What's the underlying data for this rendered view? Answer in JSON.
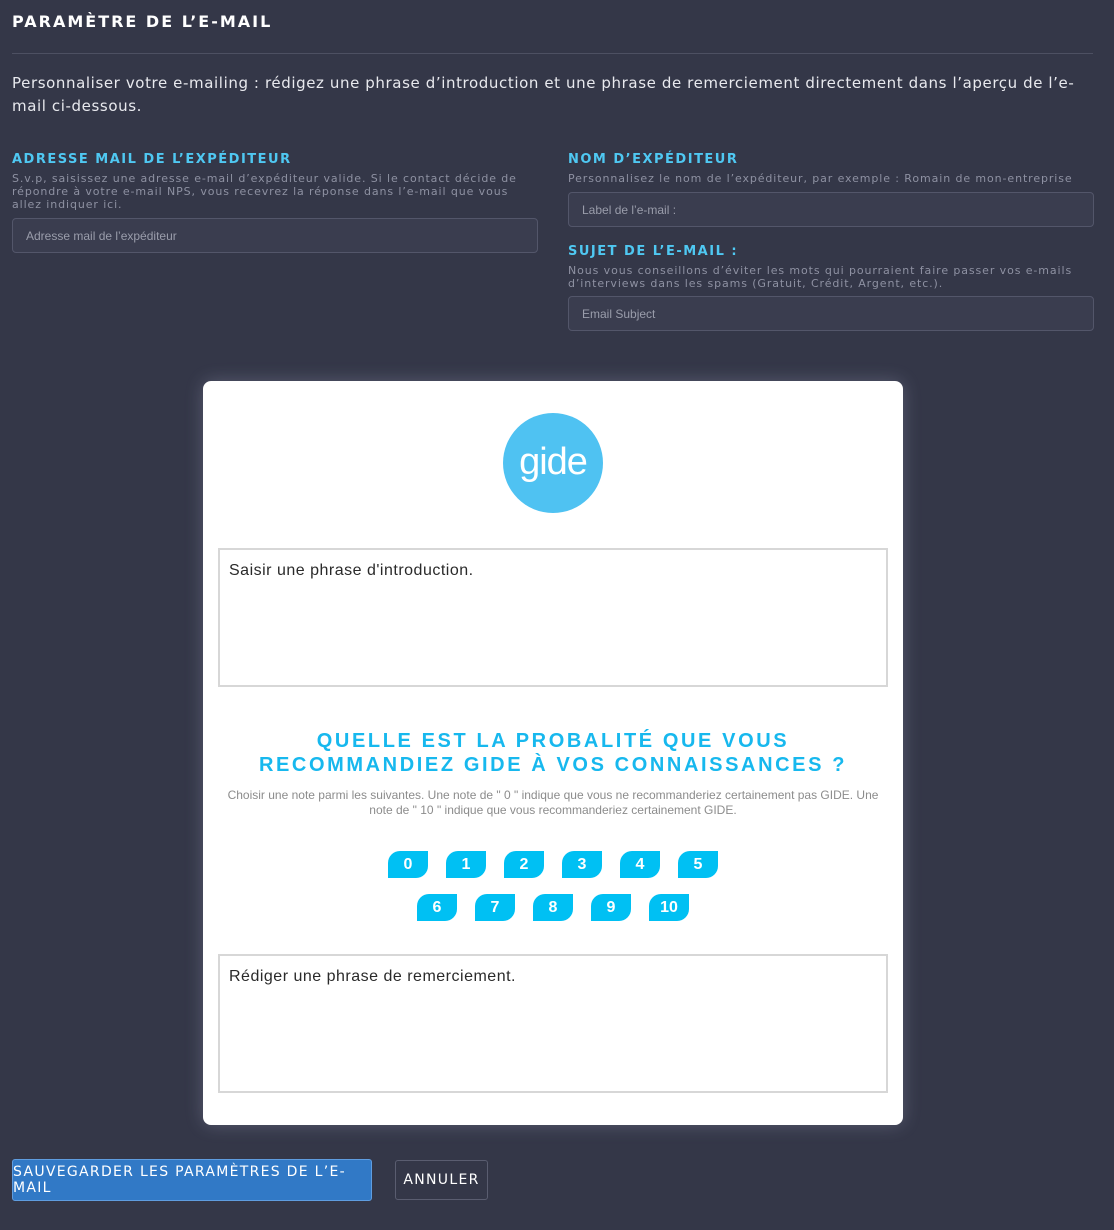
{
  "page": {
    "title": "PARAMÈTRE DE L’E-MAIL",
    "intro": "Personnaliser votre e-mailing : rédigez une phrase d’introduction et une phrase de remerciement directement dans l’aperçu de l’e-mail ci-dessous."
  },
  "sender_email": {
    "label": "ADRESSE MAIL DE L’EXPÉDITEUR",
    "help": "S.v.p, saisissez une adresse e-mail d’expéditeur valide. Si le contact décide de répondre à votre e-mail NPS, vous recevrez la réponse dans l’e-mail que vous allez indiquer ici.",
    "value": "",
    "placeholder": "Adresse mail de l’expéditeur"
  },
  "sender_name": {
    "label": "NOM D’EXPÉDITEUR",
    "help": "Personnalisez le nom de l’expéditeur, par exemple : Romain de mon-entreprise",
    "value": "",
    "placeholder": "Label de l’e-mail :"
  },
  "subject": {
    "label": "SUJET DE L’E-MAIL :",
    "help": "Nous vous conseillons d’éviter les mots qui pourraient faire passer vos e-mails d’interviews dans les spams (Gratuit, Crédit, Argent, etc.).",
    "value": "",
    "placeholder": "Email Subject"
  },
  "preview": {
    "logo_text": "gide",
    "intro_text": "Saisir une phrase d'introduction.",
    "question": "QUELLE EST LA PROBALITÉ QUE VOUS RECOMMANDIEZ GIDE À VOS CONNAISSANCES ?",
    "question_help": "Choisir une note parmi les suivantes. Une note de \" 0 \" indique que vous ne recommanderiez certainement pas GIDE. Une note de \" 10 \" indique que vous recommanderiez certainement GIDE.",
    "scores_row1": [
      "0",
      "1",
      "2",
      "3",
      "4",
      "5"
    ],
    "scores_row2": [
      "6",
      "7",
      "8",
      "9",
      "10"
    ],
    "thanks_text": "Rédiger une phrase de remerciement."
  },
  "actions": {
    "save_label": "SAUVEGARDER LES PARAMÈTRES DE L’E-MAIL",
    "cancel_label": "ANNULER"
  },
  "colors": {
    "background": "#343748",
    "accent": "#4fc8f2",
    "score_button": "#00c0f3",
    "logo": "#4fc2f2",
    "save_button": "#3179c6"
  }
}
